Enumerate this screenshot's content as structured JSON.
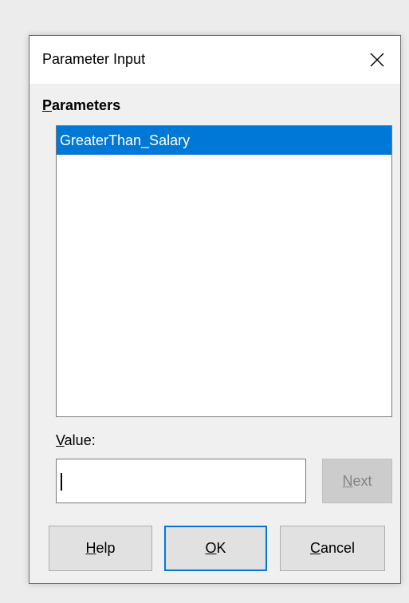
{
  "dialog": {
    "title": "Parameter Input",
    "close_icon": "close-icon"
  },
  "parameters": {
    "label_accel": "P",
    "label_rest": "arameters",
    "items": [
      {
        "label": "GreaterThan_Salary",
        "selected": true
      }
    ]
  },
  "value": {
    "label_accel": "V",
    "label_rest": "alue:",
    "input_value": ""
  },
  "buttons": {
    "next_accel": "N",
    "next_rest": "ext",
    "help_accel": "H",
    "help_rest": "elp",
    "ok_accel": "O",
    "ok_rest": "K",
    "cancel_accel": "C",
    "cancel_rest": "ancel"
  },
  "colors": {
    "selection": "#0078d7",
    "default_button_border": "#0078d7"
  }
}
